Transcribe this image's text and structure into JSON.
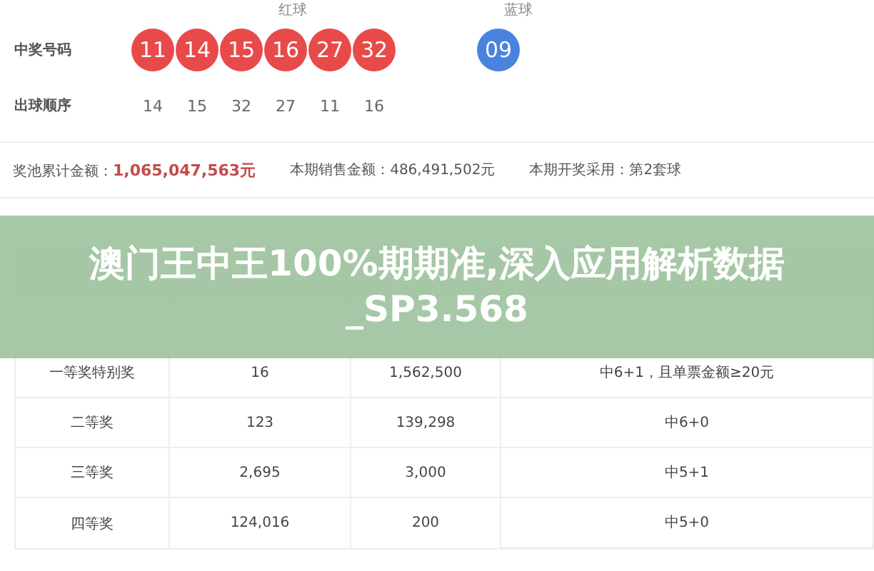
{
  "draw": {
    "red_header": "红球",
    "blue_header": "蓝球",
    "winning": {
      "label": "中奖号码",
      "red": [
        "11",
        "14",
        "15",
        "16",
        "27",
        "32"
      ],
      "blue": [
        "09"
      ]
    },
    "order": {
      "label": "出球顺序",
      "numbers": [
        "14",
        "15",
        "32",
        "27",
        "11",
        "16"
      ]
    }
  },
  "summary": [
    {
      "label": "奖池累计金额：",
      "value": "1,065,047,563元",
      "highlight": true
    },
    {
      "label": "本期销售金额：",
      "value": "486,491,502元",
      "highlight": false
    },
    {
      "label": "本期开奖采用：",
      "value": "第2套球",
      "highlight": false
    }
  ],
  "table": {
    "rows": [
      {
        "prize": "一等奖特别奖",
        "count": "16",
        "amount": "1,562,500",
        "conditions": [
          "中6+1，且单票金额≥20元"
        ]
      },
      {
        "prize": "二等奖",
        "count": "123",
        "amount": "139,298",
        "conditions": [
          "中6+0"
        ]
      },
      {
        "prize": "三等奖",
        "count": "2,695",
        "amount": "3,000",
        "conditions": [
          "中5+1"
        ]
      },
      {
        "prize": "四等奖",
        "count": "124,016",
        "amount": "200",
        "conditions": [
          "中5+0"
        ]
      }
    ]
  },
  "banner": {
    "title": "澳门王中王100%期期准,深入应用解析数据_SP3.568"
  }
}
